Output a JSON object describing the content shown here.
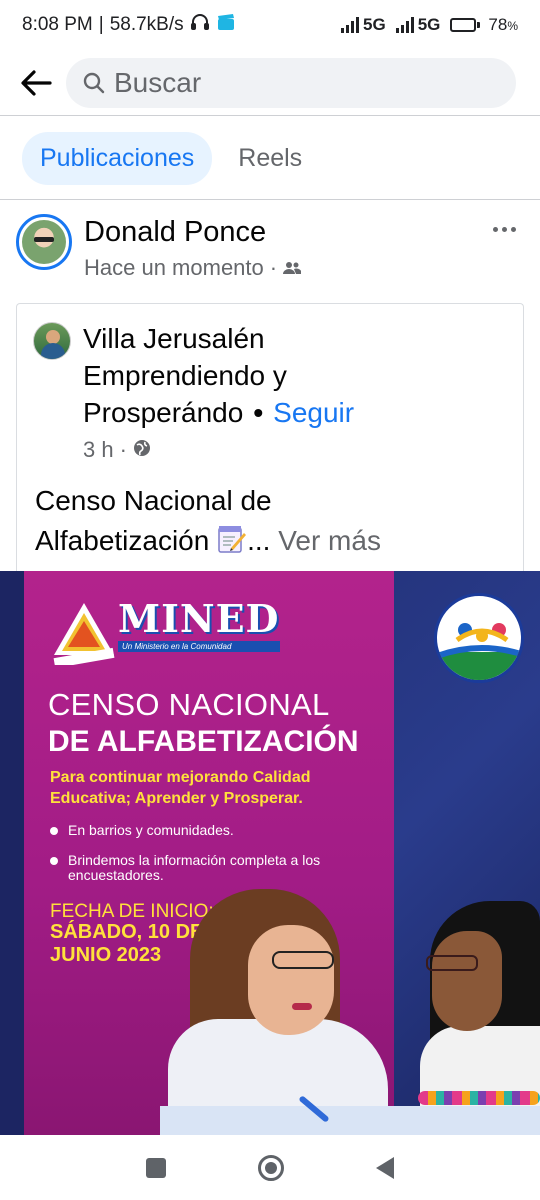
{
  "status_bar": {
    "time": "8:08 PM",
    "separator": "|",
    "speed": "58.7kB/s",
    "net1": "5G",
    "net2": "5G",
    "battery_pct": "78",
    "battery_unit": "%",
    "battery_level": 0.78
  },
  "search": {
    "placeholder": "Buscar"
  },
  "tabs": [
    {
      "label": "Publicaciones",
      "active": true
    },
    {
      "label": "Reels",
      "active": false
    }
  ],
  "post": {
    "author": "Donald Ponce",
    "time": "Hace un momento",
    "audience_icon": "friends-icon",
    "shared": {
      "page_name_line1": "Villa Jerusalén",
      "page_name_line2": "Emprendiendo y",
      "page_name_line3": "Prosperándo",
      "follow_dot": "•",
      "follow_label": "Seguir",
      "time": "3 h",
      "privacy_icon": "globe-icon",
      "text_line1": "Censo Nacional de",
      "text_line2": "Alfabetización",
      "ellipsis": "...",
      "see_more": "Ver más"
    }
  },
  "poster": {
    "logo_word": "MINED",
    "logo_tagline": "Un Ministerio en la Comunidad",
    "title_line1": "CENSO NACIONAL",
    "title_line2": "DE ALFABETIZACIÓN",
    "subtitle": "Para continuar mejorando Calidad Educativa; Aprender y Prosperar.",
    "bullets": [
      "En barrios y comunidades.",
      "Brindemos la información completa a los encuestadores."
    ],
    "date_label": "FECHA DE INICIO:",
    "date_value": "SÁBADO, 10 DE JUNIO 2023"
  },
  "colors": {
    "accent": "#1877f2",
    "poster_magenta": "#a21c86",
    "poster_yellow": "#ffe13b",
    "poster_navy": "#1d2a6b"
  }
}
